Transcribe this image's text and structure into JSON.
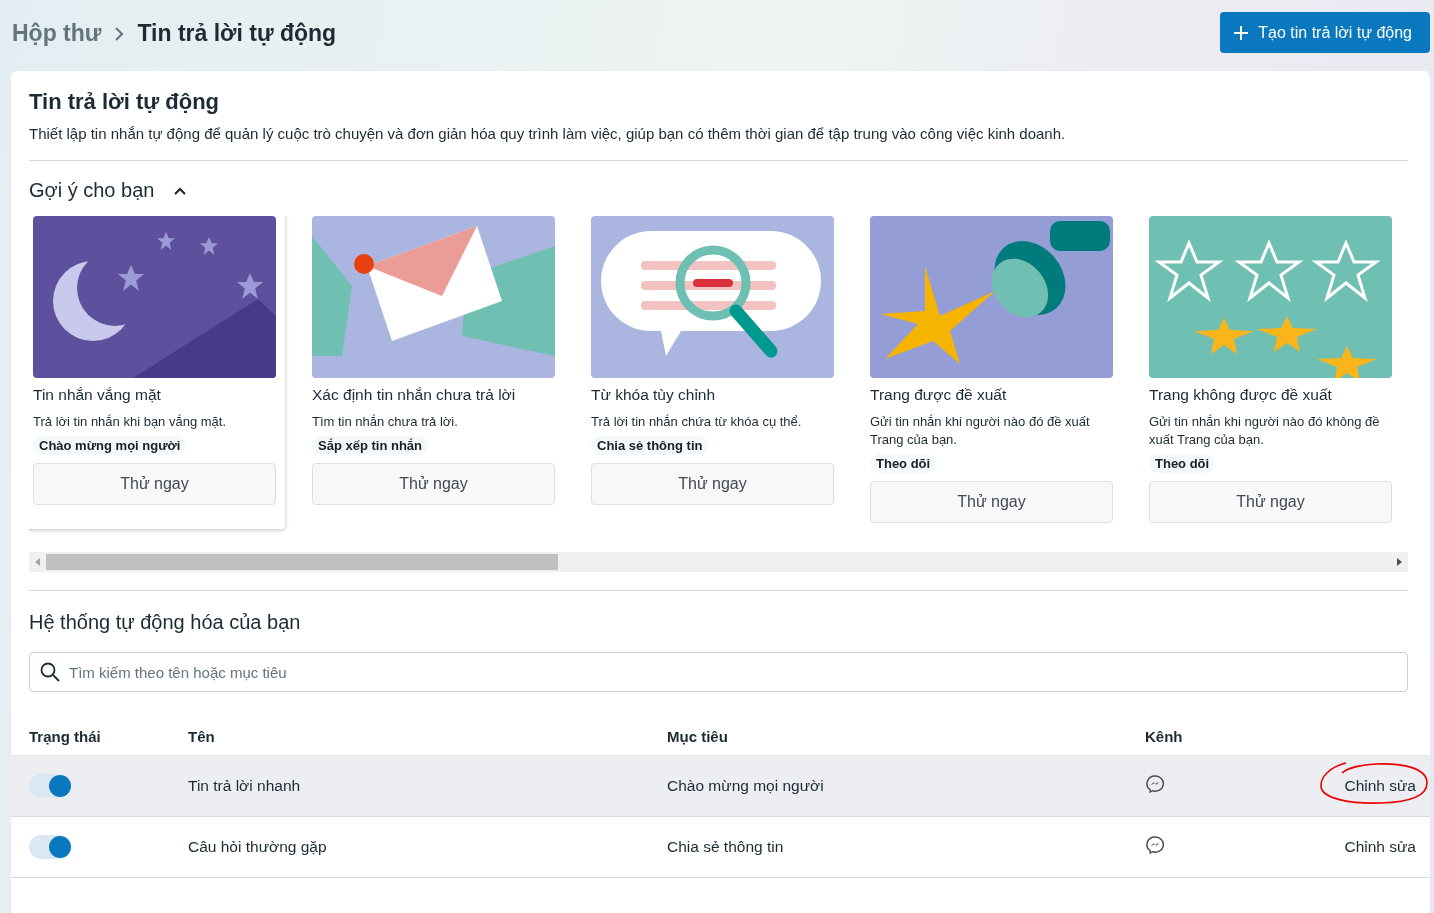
{
  "breadcrumb": {
    "parent": "Hộp thư",
    "current": "Tin trả lời tự động"
  },
  "create_button": {
    "label": "Tạo tin trả lời tự động"
  },
  "intro": {
    "title": "Tin trả lời tự động",
    "description": "Thiết lập tin nhắn tự động để quản lý cuộc trò chuyện và đơn giản hóa quy trình làm việc, giúp bạn có thêm thời gian để tập trung vào công việc kinh doanh."
  },
  "suggestions": {
    "title": "Gợi ý cho bạn",
    "expanded": true,
    "cards": [
      {
        "kind": "moon",
        "title": "Tin nhắn vắng mặt",
        "description": "Trả lời tin nhắn khi bạn vắng mặt.",
        "tag": "Chào mừng mọi người",
        "button": "Thử ngay",
        "selected": true
      },
      {
        "kind": "envelope",
        "title": "Xác định tin nhắn chưa trả lời",
        "description": "Tìm tin nhắn chưa trả lời.",
        "tag": "Sắp xếp tin nhắn",
        "button": "Thử ngay",
        "selected": false
      },
      {
        "kind": "magnifier",
        "title": "Từ khóa tùy chỉnh",
        "description": "Trả lời tin nhắn chứa từ khóa cụ thể.",
        "tag": "Chia sẻ thông tin",
        "button": "Thử ngay",
        "selected": false
      },
      {
        "kind": "stamp",
        "title": "Trang được đề xuất",
        "description": "Gửi tin nhắn khi người nào đó đề xuất Trang của bạn.",
        "tag": "Theo dõi",
        "button": "Thử ngay",
        "selected": false
      },
      {
        "kind": "stars",
        "title": "Trang không được đề xuất",
        "description": "Gửi tin nhắn khi người nào đó không đề xuất Trang của bạn.",
        "tag": "Theo dõi",
        "button": "Thử ngay",
        "selected": false
      }
    ]
  },
  "automations": {
    "title": "Hệ thống tự động hóa của bạn",
    "search": {
      "placeholder": "Tìm kiếm theo tên hoặc mục tiêu"
    },
    "columns": [
      "Trạng thái",
      "Tên",
      "Mục tiêu",
      "Kênh"
    ],
    "rows": [
      {
        "on": true,
        "name": "Tin trả lời nhanh",
        "goal": "Chào mừng mọi người",
        "action": "Chỉnh sửa",
        "hovered": true,
        "circled": true
      },
      {
        "on": true,
        "name": "Câu hỏi thường gặp",
        "goal": "Chia sẻ thông tin",
        "action": "Chỉnh sửa",
        "hovered": false,
        "circled": false
      }
    ]
  }
}
